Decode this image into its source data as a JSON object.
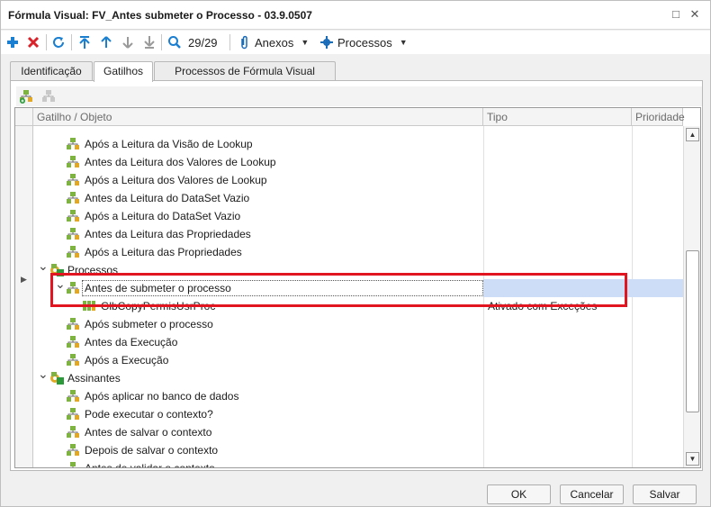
{
  "window": {
    "title": "Fórmula Visual: FV_Antes submeter o Processo - 03.9.0507",
    "restore_glyph": "□",
    "close_glyph": "✕"
  },
  "toolbar": {
    "counter": "29/29",
    "anexos_label": "Anexos",
    "processos_label": "Processos"
  },
  "tabs": [
    {
      "label": "Identificação"
    },
    {
      "label": "Gatilhos"
    },
    {
      "label": "Processos de Fórmula Visual"
    }
  ],
  "grid": {
    "columns": [
      "Gatilho / Objeto",
      "Tipo",
      "Prioridade"
    ],
    "rows": [
      {
        "label": "Após a Leitura da Visão de Lookup",
        "tipo": ""
      },
      {
        "label": "Antes da Leitura dos Valores de Lookup",
        "tipo": ""
      },
      {
        "label": "Após a Leitura dos Valores de Lookup",
        "tipo": ""
      },
      {
        "label": "Antes da Leitura do DataSet Vazio",
        "tipo": ""
      },
      {
        "label": "Após a Leitura do DataSet Vazio",
        "tipo": ""
      },
      {
        "label": "Antes da Leitura das Propriedades",
        "tipo": ""
      },
      {
        "label": "Após a Leitura das Propriedades",
        "tipo": ""
      },
      {
        "label": "Processos",
        "tipo": ""
      },
      {
        "label": "Antes de submeter o processo",
        "tipo": ""
      },
      {
        "label": "GlbCopyPermisUsrProc",
        "tipo": "Ativado com Exceções"
      },
      {
        "label": "Após submeter o processo",
        "tipo": ""
      },
      {
        "label": "Antes da Execução",
        "tipo": ""
      },
      {
        "label": "Após a Execução",
        "tipo": ""
      },
      {
        "label": "Assinantes",
        "tipo": ""
      },
      {
        "label": "Após aplicar no banco de dados",
        "tipo": ""
      },
      {
        "label": "Pode executar o contexto?",
        "tipo": ""
      },
      {
        "label": "Antes de salvar o contexto",
        "tipo": ""
      },
      {
        "label": "Depois de salvar o contexto",
        "tipo": ""
      },
      {
        "label": "Antes de validar o contexto",
        "tipo": ""
      }
    ]
  },
  "footer": {
    "ok_label": "OK",
    "cancel_label": "Cancelar",
    "save_label": "Salvar"
  },
  "colors": {
    "highlight": "#e0151f",
    "selection": "#cddcf7",
    "add_icon": "#1a7fd1",
    "delete_icon": "#d9232b"
  }
}
